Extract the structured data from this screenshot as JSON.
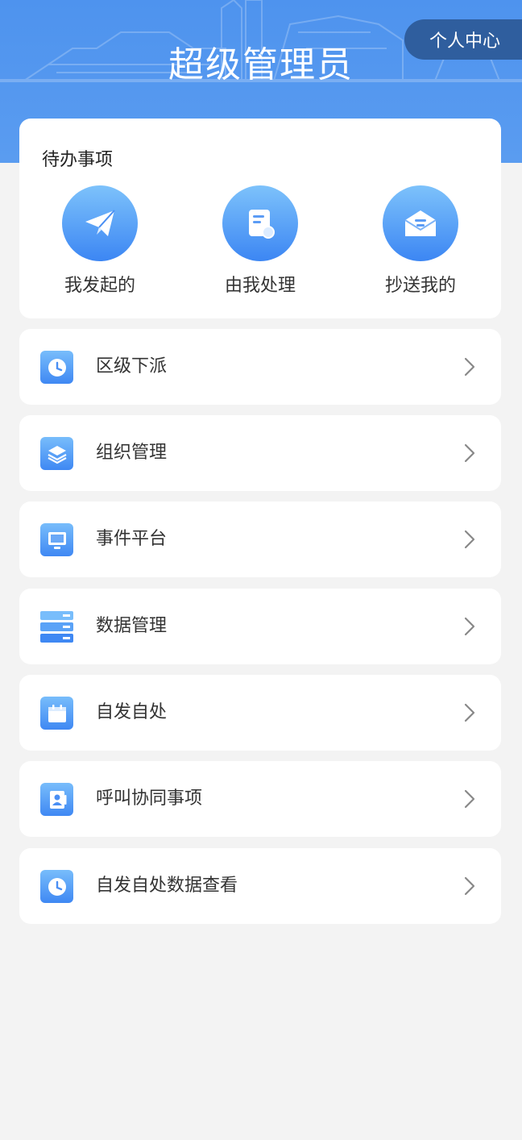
{
  "header": {
    "title": "超级管理员",
    "profile_button": "个人中心",
    "background_color": "#4e93ee"
  },
  "pending": {
    "title": "待办事项",
    "actions": [
      {
        "label": "我发起的",
        "icon": "paper-plane-icon"
      },
      {
        "label": "由我处理",
        "icon": "document-icon"
      },
      {
        "label": "抄送我的",
        "icon": "envelope-icon"
      }
    ]
  },
  "menu": {
    "items": [
      {
        "label": "区级下派",
        "icon": "clock-icon"
      },
      {
        "label": "组织管理",
        "icon": "layers-icon"
      },
      {
        "label": "事件平台",
        "icon": "monitor-icon"
      },
      {
        "label": "数据管理",
        "icon": "database-icon"
      },
      {
        "label": "自发自处",
        "icon": "calendar-icon"
      },
      {
        "label": "呼叫协同事项",
        "icon": "contact-card-icon"
      },
      {
        "label": "自发自处数据查看",
        "icon": "clock-icon"
      }
    ]
  },
  "colors": {
    "accent": "#3c86f3",
    "accent_light": "#7dc2fb",
    "page_bg": "#f3f3f3",
    "profile_bg": "#2f5e9e"
  }
}
